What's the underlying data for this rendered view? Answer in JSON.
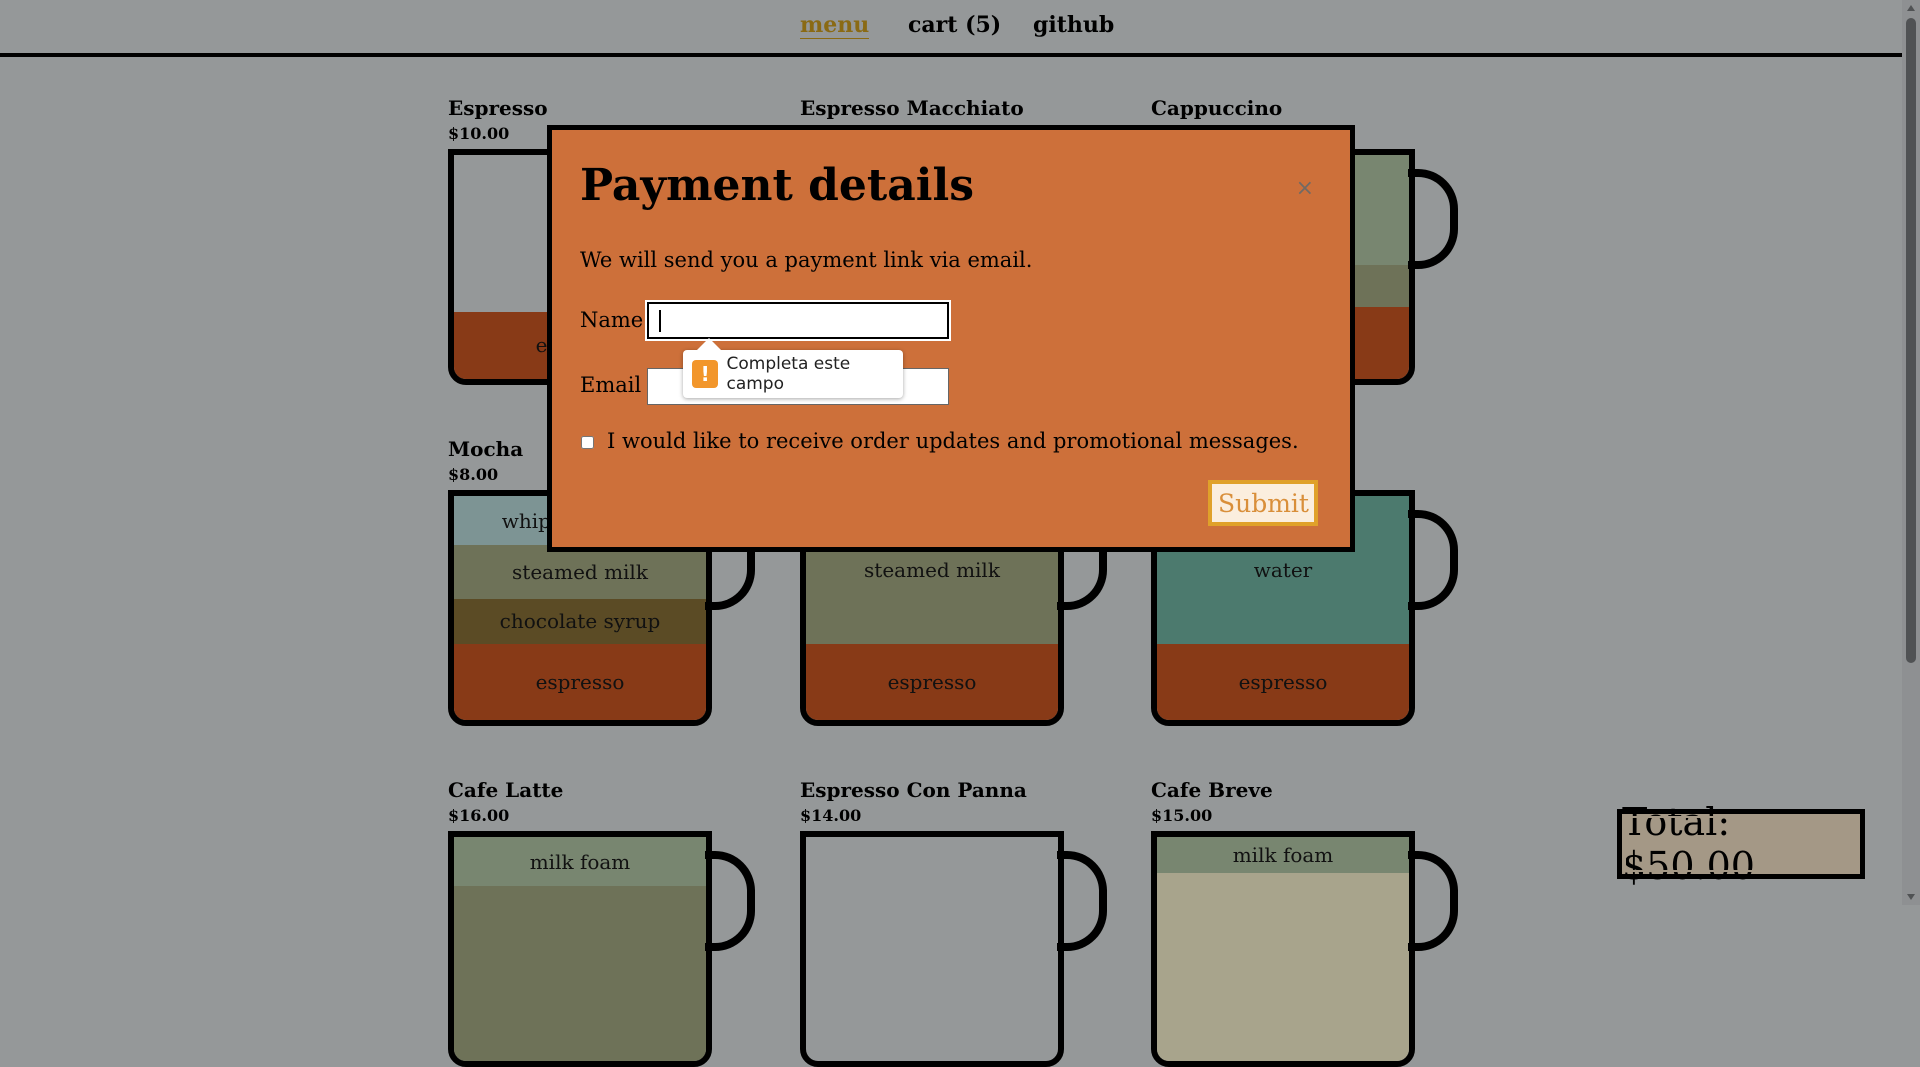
{
  "nav": {
    "menu": "menu",
    "cart": "cart (5)",
    "github": "github"
  },
  "colors": {
    "page_bg": "#959899",
    "espresso": "#883a17",
    "milk_foam": "#788670",
    "steamed_milk": "#6e7258",
    "chocolate_syrup": "#5b4b25",
    "whipped_cream": "#7d9494",
    "water": "#4c7a6e",
    "modal_bg": "#cd703a",
    "submit_border": "#e0a12a",
    "total_bg": "#a49886",
    "nav_active": "#8a6a14"
  },
  "products": [
    {
      "name": "Espresso",
      "price": "$10.00",
      "layers": [
        {
          "label": "espresso",
          "color": "espresso",
          "size": 0.3
        }
      ]
    },
    {
      "name": "Espresso Macchiato",
      "price": "",
      "layers": []
    },
    {
      "name": "Cappuccino",
      "price": "",
      "layers": [
        {
          "label": "",
          "color": "milkfoam",
          "size": 0.49
        },
        {
          "label": "",
          "color": "steamed",
          "size": 0.19
        },
        {
          "label": "",
          "color": "espresso",
          "size": 0.32
        }
      ]
    },
    {
      "name": "Mocha",
      "price": "$8.00",
      "layers": [
        {
          "label": "whipped cream",
          "color": "whipped",
          "size": 0.22
        },
        {
          "label": "steamed milk",
          "color": "steamed",
          "size": 0.24
        },
        {
          "label": "chocolate syrup",
          "color": "choc",
          "size": 0.2
        },
        {
          "label": "espresso",
          "color": "espresso",
          "size": 0.34
        }
      ]
    },
    {
      "name": "",
      "price": "",
      "layers": [
        {
          "label": "steamed milk",
          "color": "steamed",
          "size": 0.66
        },
        {
          "label": "espresso",
          "color": "espresso",
          "size": 0.34
        }
      ]
    },
    {
      "name": "",
      "price": "",
      "layers": [
        {
          "label": "water",
          "color": "water",
          "size": 0.66
        },
        {
          "label": "espresso",
          "color": "espresso",
          "size": 0.34
        }
      ]
    },
    {
      "name": "Cafe Latte",
      "price": "$16.00",
      "layers": [
        {
          "label": "milk foam",
          "color": "milkfoam",
          "size": 0.22
        },
        {
          "label": "",
          "color": "steamed",
          "size": 0.78
        }
      ]
    },
    {
      "name": "Espresso Con Panna",
      "price": "$14.00",
      "layers": []
    },
    {
      "name": "Cafe Breve",
      "price": "$15.00",
      "layers": [
        {
          "label": "milk foam",
          "color": "milkfoam",
          "size": 0.16
        },
        {
          "label": "",
          "color": "halfhalf",
          "size": 0.84
        }
      ]
    }
  ],
  "modal": {
    "title": "Payment details",
    "close": "×",
    "intro": "We will send you a payment link via email.",
    "name_label": "Name",
    "name_value": "",
    "email_label": "Email",
    "email_value": "",
    "checkbox_label": "I would like to receive order updates and promotional messages.",
    "checkbox_checked": false,
    "submit": "Submit"
  },
  "validation": {
    "message": "Completa este campo",
    "icon": "!"
  },
  "total": "Total: $50.00"
}
